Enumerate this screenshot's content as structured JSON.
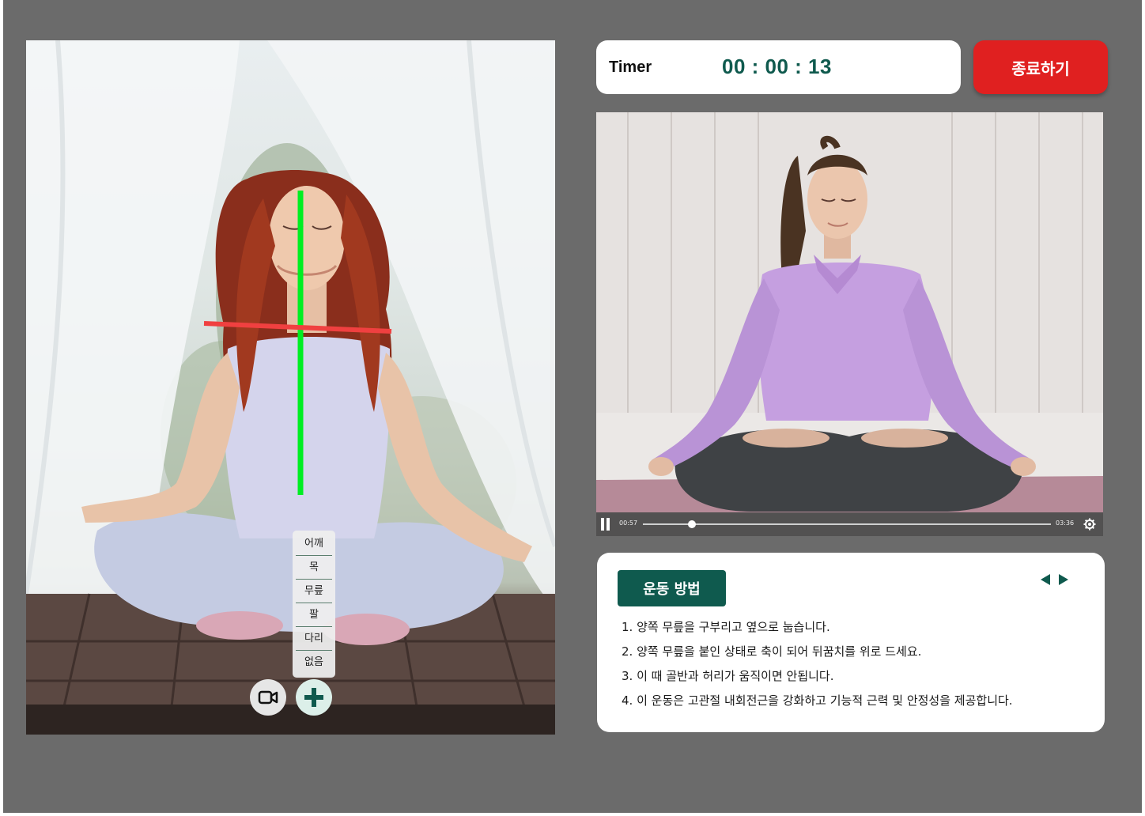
{
  "camera": {
    "body_parts": [
      "어깨",
      "목",
      "무릎",
      "팔",
      "다리",
      "없음"
    ],
    "camera_toggle_icon": "video-camera-icon",
    "add_icon": "plus-icon",
    "guide_colors": {
      "vertical": "#00ee22",
      "horizontal": "#f04040"
    }
  },
  "timer": {
    "label": "Timer",
    "value": "00 : 00 : 13"
  },
  "end_button": {
    "label": "종료하기",
    "color": "#e02020"
  },
  "video": {
    "current_time": "00:57",
    "duration": "03:36",
    "progress": 0.12
  },
  "instructions": {
    "title": "운동 방법",
    "steps": [
      "1. 양쪽 무릎을 구부리고 옆으로 눕습니다.",
      "2. 양쪽 무릎을 붙인 상태로 축이 되어 뒤꿈치를 위로 드세요.",
      "3. 이 때 골반과 허리가 움직이면 안됩니다.",
      "4. 이 운동은 고관절 내회전근을 강화하고 기능적 근력 및 안정성을 제공합니다."
    ]
  },
  "colors": {
    "accent": "#0f5a4e",
    "danger": "#e02020",
    "background": "#6b6b6b"
  }
}
